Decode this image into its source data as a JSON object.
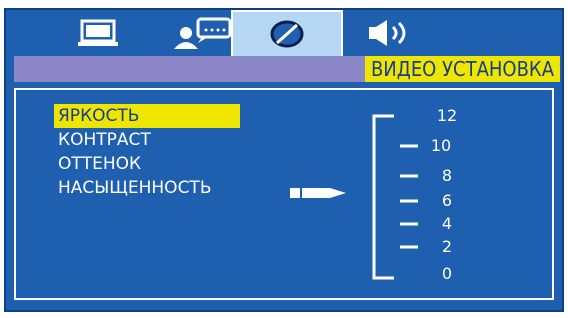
{
  "tabs": [
    {
      "name": "monitor-icon",
      "active": false
    },
    {
      "name": "user-chat-icon",
      "active": false
    },
    {
      "name": "contrast-disc-icon",
      "active": true
    },
    {
      "name": "speaker-icon",
      "active": false
    }
  ],
  "header": {
    "title": "ВИДЕО УСТАНОВКА"
  },
  "menu": {
    "items": [
      "ЯРКОСТЬ",
      "КОНТРАСТ",
      "ОТТЕНОК",
      "НАСЫЩЕННОСТЬ"
    ],
    "selected": 0
  },
  "scale": {
    "labels": [
      "12",
      "10",
      "8",
      "6",
      "4",
      "2",
      "0"
    ]
  },
  "colors": {
    "background": "#1f5fb0",
    "highlight": "#efe600",
    "header_bar": "#8a86c8",
    "active_tab": "#b6d7f3"
  }
}
